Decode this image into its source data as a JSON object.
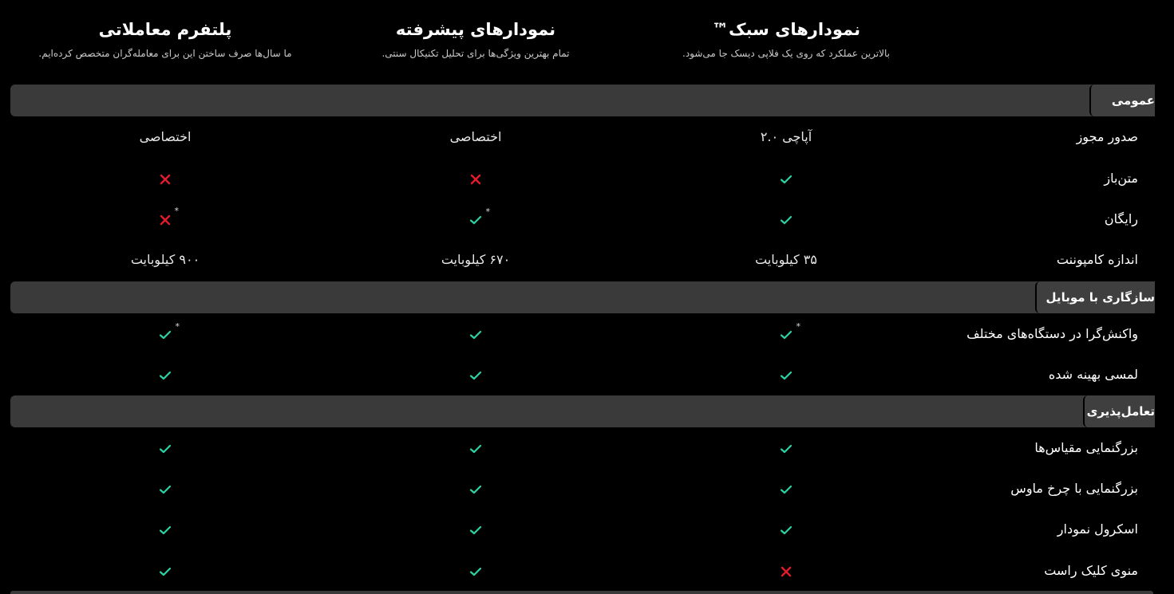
{
  "colors": {
    "check": "#2bd4a4",
    "cross": "#e21b2d",
    "section_bg": "#3a3a3a"
  },
  "columns": [
    {
      "title": "نمودارهای سبک™",
      "subtitle": "بالاترین عملکرد که روی یک فلاپی دیسک جا می‌شود."
    },
    {
      "title": "نمودارهای پیشرفته",
      "subtitle": "تمام بهترین ویژگی‌ها برای تحلیل تکنیکال سنتی."
    },
    {
      "title": "پلتفرم معاملاتی",
      "subtitle": "ما سال‌ها صرف ساختن این برای معامله‌گران متخصص کرده‌ایم."
    }
  ],
  "sections": [
    {
      "label": "عمومی",
      "rows": [
        {
          "feature": "صدور مجوز",
          "cells": [
            {
              "text": "آپاچی ۲.۰"
            },
            {
              "text": "اختصاصی"
            },
            {
              "text": "اختصاصی"
            }
          ]
        },
        {
          "feature": "متن‌باز",
          "cells": [
            {
              "icon": "check-icon"
            },
            {
              "icon": "cross-icon"
            },
            {
              "icon": "cross-icon"
            }
          ]
        },
        {
          "feature": "رایگان",
          "cells": [
            {
              "icon": "check-icon"
            },
            {
              "icon": "check-icon",
              "note": "*"
            },
            {
              "icon": "cross-icon",
              "note": "*"
            }
          ]
        },
        {
          "feature": "اندازه کامپوننت",
          "cells": [
            {
              "text": "۳۵ کیلوبایت"
            },
            {
              "text": "۶۷۰ کیلوبایت"
            },
            {
              "text": "۹۰۰ کیلوبایت"
            }
          ]
        }
      ]
    },
    {
      "label": "سازگاری با موبایل",
      "rows": [
        {
          "feature": "واکنش‌گرا در دستگاه‌های مختلف",
          "cells": [
            {
              "icon": "check-icon",
              "note": "*"
            },
            {
              "icon": "check-icon"
            },
            {
              "icon": "check-icon",
              "note": "*"
            }
          ]
        },
        {
          "feature": "لمسی بهینه شده",
          "cells": [
            {
              "icon": "check-icon"
            },
            {
              "icon": "check-icon"
            },
            {
              "icon": "check-icon"
            }
          ]
        }
      ]
    },
    {
      "label": "تعامل‌پذیری",
      "rows": [
        {
          "feature": "بزرگنمایی مقیاس‌ها",
          "cells": [
            {
              "icon": "check-icon"
            },
            {
              "icon": "check-icon"
            },
            {
              "icon": "check-icon"
            }
          ]
        },
        {
          "feature": "بزرگنمایی با چرخ ماوس",
          "cells": [
            {
              "icon": "check-icon"
            },
            {
              "icon": "check-icon"
            },
            {
              "icon": "check-icon"
            }
          ]
        },
        {
          "feature": "اسکرول نمودار",
          "cells": [
            {
              "icon": "check-icon"
            },
            {
              "icon": "check-icon"
            },
            {
              "icon": "check-icon"
            }
          ]
        },
        {
          "feature": "منوی کلیک راست",
          "cells": [
            {
              "icon": "cross-icon"
            },
            {
              "icon": "check-icon"
            },
            {
              "icon": "check-icon"
            }
          ]
        }
      ]
    }
  ]
}
